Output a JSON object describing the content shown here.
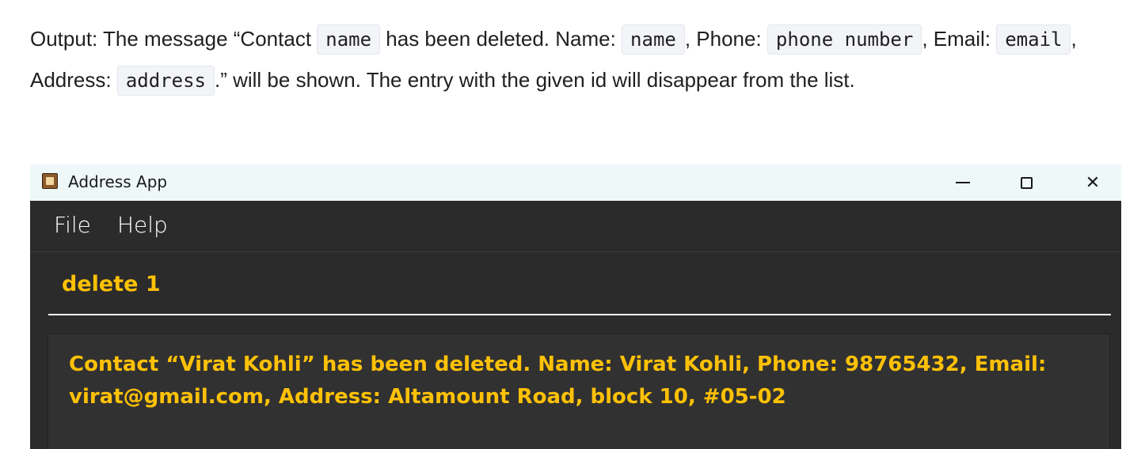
{
  "doc": {
    "output_label": "Output: The message “Contact ",
    "code_name_1": "name",
    "text_after_name_1": " has been deleted. Name: ",
    "code_name_2": "name",
    "text_phone": ", Phone: ",
    "code_phone": "phone number",
    "text_email": ", Email: ",
    "code_email": "email",
    "text_address": ", Address: ",
    "code_address": "address",
    "text_end": ".” will be shown. The entry with the given id will disappear from the list."
  },
  "window": {
    "title": "Address App",
    "controls": {
      "close_glyph": "✕"
    }
  },
  "menu": {
    "file": "File",
    "help": "Help"
  },
  "command": {
    "value": "delete 1"
  },
  "result": {
    "message": "Contact “Virat Kohli” has been deleted. Name: Virat Kohli, Phone: 98765432, Email: virat@gmail.com, Address: Altamount Road, block 10, #05-02"
  },
  "colors": {
    "accent": "#ffc107",
    "window_bg": "#2b2b2b",
    "titlebar_bg": "#eef8f8"
  }
}
